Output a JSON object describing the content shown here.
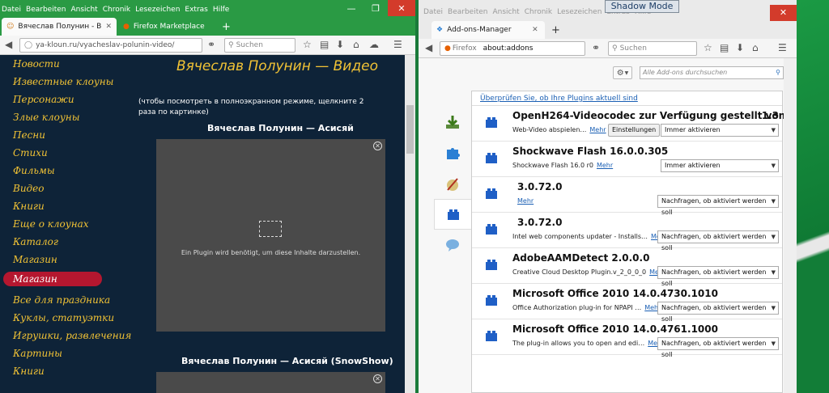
{
  "left": {
    "menu": [
      "Datei",
      "Bearbeiten",
      "Ansicht",
      "Chronik",
      "Lesezeichen",
      "Extras",
      "Hilfe"
    ],
    "tabs": [
      {
        "label": "Вячеслав Полунин - Виде…"
      },
      {
        "label": "Firefox Marketplace"
      }
    ],
    "url": "ya-kloun.ru/vyacheslav-polunin-video/",
    "search_placeholder": "Suchen",
    "nav_items": [
      "Новости",
      "Известные клоуны",
      "Персонажи",
      "Злые клоуны",
      "Песни",
      "Стихи",
      "Фильмы",
      "Видео",
      "Книги",
      "Еще о клоунах",
      "Каталог",
      "Магазин"
    ],
    "shop_pill": "Магазин",
    "shop_items": [
      "Все для праздника",
      "Куклы, статуэтки",
      "Игрушки, развлечения",
      "Картины",
      "Книги"
    ],
    "page_title": "Вячеслав Полунин — Видео",
    "hint": "(чтобы посмотреть в полноэкранном режиме, щелкните 2 раза по картинке)",
    "video1_title": "Вячеслав Полунин — Асисяй",
    "plugin_msg": "Ein Plugin wird benötigt, um diese Inhalte darzustellen.",
    "video2_title": "Вячеслав Полунин — Асисяй (SnowShow)"
  },
  "right": {
    "menu": [
      "Datei",
      "Bearbeiten",
      "Ansicht",
      "Chronik",
      "Lesezeichen",
      "Extras",
      "Hilfe"
    ],
    "shadow_mode": "Shadow Mode",
    "tab_label": "Add-ons-Manager",
    "url_identity": "Firefox",
    "url": "about:addons",
    "search_placeholder": "Suchen",
    "addon_search_placeholder": "Alle Add-ons durchsuchen",
    "notice": "Überprüfen Sie, ob Ihre Plugins aktuell sind",
    "more_label": "Mehr",
    "plugins": [
      {
        "name": "OpenH264-Videocodec zur Verfügung gestellt von …",
        "version": "1.3",
        "desc": "Web-Video abspielen…",
        "button": "Einstellungen",
        "state": "Immer aktivieren"
      },
      {
        "name": "Shockwave Flash  16.0.0.305",
        "version": "",
        "desc": "Shockwave Flash 16.0 r0",
        "button": "",
        "state": "Immer aktivieren"
      },
      {
        "name": "3.0.72.0",
        "version": "",
        "desc": "",
        "button": "",
        "state": "Nachfragen, ob aktiviert werden soll"
      },
      {
        "name": "3.0.72.0",
        "version": "",
        "desc": "Intel web components updater - Installs…",
        "button": "",
        "state": "Nachfragen, ob aktiviert werden soll"
      },
      {
        "name": "AdobeAAMDetect  2.0.0.0",
        "version": "",
        "desc": "Creative Cloud Desktop Plugin.v_2_0_0_0",
        "button": "",
        "state": "Nachfragen, ob aktiviert werden soll"
      },
      {
        "name": "Microsoft Office 2010  14.0.4730.1010",
        "version": "",
        "desc": "Office Authorization plug-in for NPAPI …",
        "button": "",
        "state": "Nachfragen, ob aktiviert werden soll"
      },
      {
        "name": "Microsoft Office 2010  14.0.4761.1000",
        "version": "",
        "desc": "The plug-in allows you to open and edi…",
        "button": "",
        "state": "Nachfragen, ob aktiviert werden soll"
      }
    ]
  }
}
